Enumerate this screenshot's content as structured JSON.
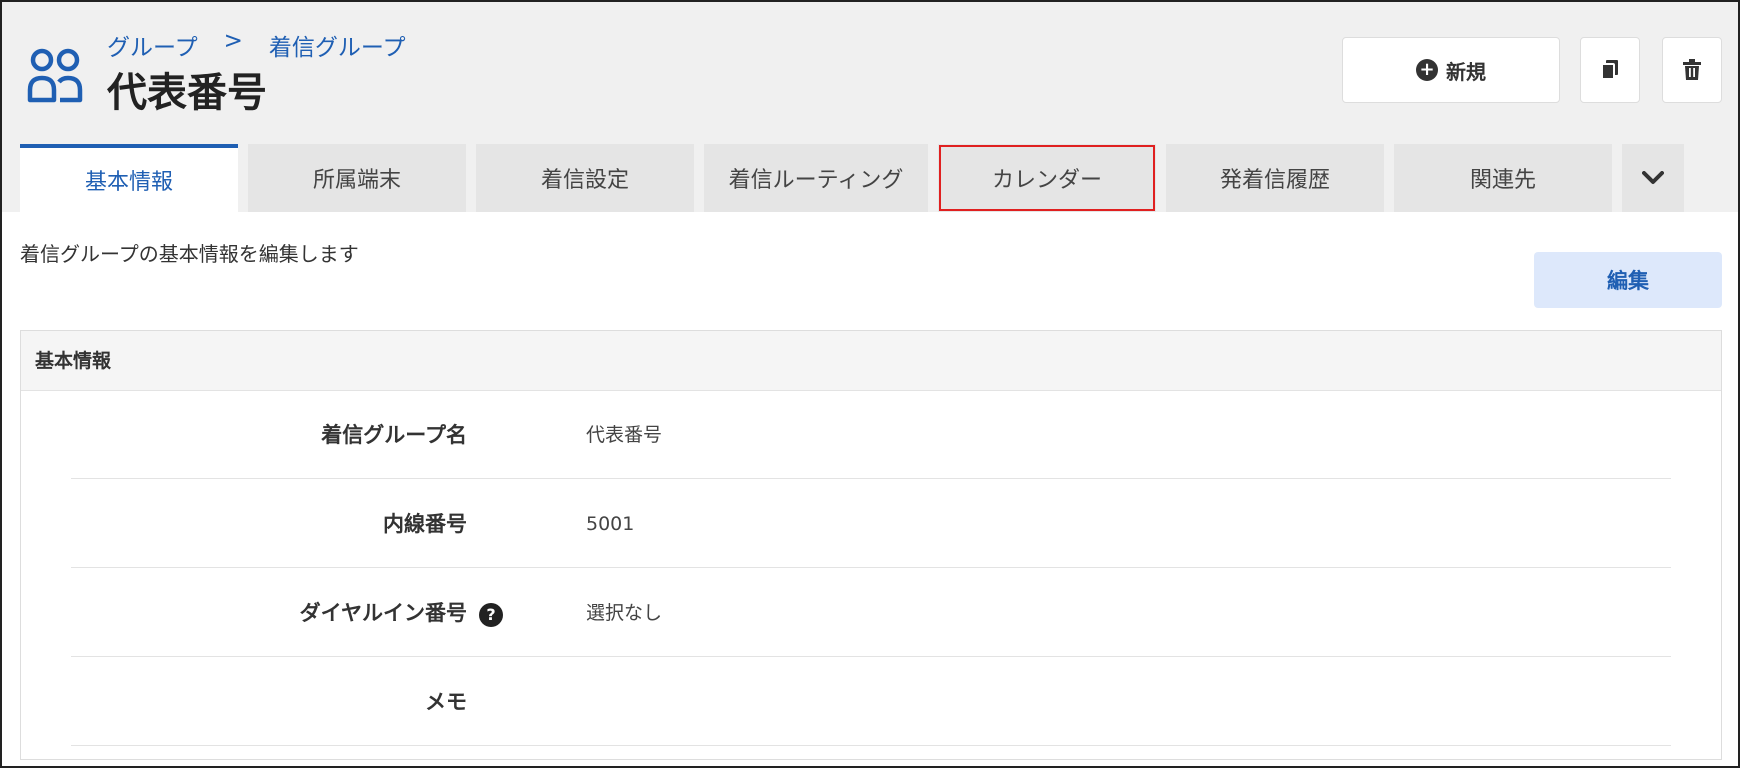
{
  "header": {
    "breadcrumb": [
      "グループ",
      ">",
      "着信グループ"
    ],
    "title": "代表番号",
    "new_button_label": "新規"
  },
  "tabs": [
    {
      "label": "基本情報",
      "active": true
    },
    {
      "label": "所属端末"
    },
    {
      "label": "着信設定"
    },
    {
      "label": "着信ルーティング"
    },
    {
      "label": "カレンダー",
      "highlighted": true
    },
    {
      "label": "発着信履歴"
    },
    {
      "label": "関連先"
    }
  ],
  "content": {
    "description": "着信グループの基本情報を編集します",
    "edit_button_label": "編集",
    "panel_title": "基本情報",
    "fields": [
      {
        "label": "着信グループ名",
        "value": "代表番号"
      },
      {
        "label": "内線番号",
        "value": "5001"
      },
      {
        "label": "ダイヤルイン番号",
        "value": "選択なし",
        "help_icon": "question-icon"
      },
      {
        "label": "メモ",
        "value": ""
      }
    ]
  },
  "colors": {
    "accent": "#1f5fb3",
    "highlight": "#e02020",
    "edit_button_bg": "#dde8fb"
  }
}
